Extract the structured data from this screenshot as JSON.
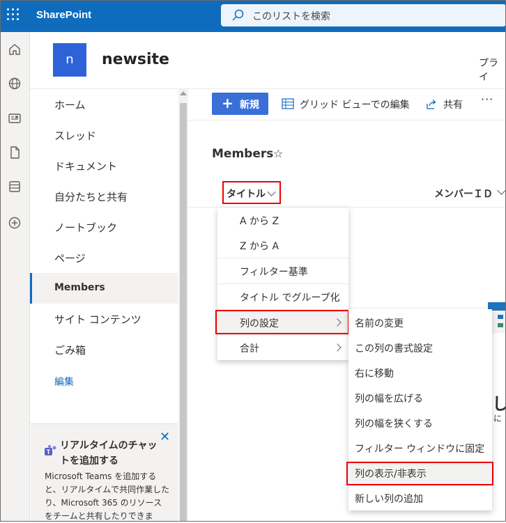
{
  "app": {
    "brand": "SharePoint"
  },
  "search": {
    "placeholder": "このリストを検索"
  },
  "rail": {
    "icons": [
      "home-icon",
      "globe-icon",
      "news-icon",
      "document-icon",
      "list-icon",
      "add-circle-icon"
    ]
  },
  "site": {
    "logo_letter": "n",
    "title": "newsite",
    "header_right_text": "プライ"
  },
  "nav": {
    "items": [
      {
        "label": "ホーム"
      },
      {
        "label": "スレッド"
      },
      {
        "label": "ドキュメント"
      },
      {
        "label": "自分たちと共有"
      },
      {
        "label": "ノートブック"
      },
      {
        "label": "ページ"
      },
      {
        "label": "Members",
        "active": true
      },
      {
        "label": "サイト コンテンツ"
      },
      {
        "label": "ごみ箱"
      }
    ],
    "edit_label": "編集"
  },
  "promo": {
    "title": "リアルタイムのチャットを追加する",
    "body": "Microsoft Teams を追加すると、リアルタイムで共同作業したり、Microsoft 365 のリソースをチームと共有したりできま"
  },
  "toolbar": {
    "new_label": "新規",
    "grid_edit_label": "グリッド ビューでの編集",
    "share_label": "共有",
    "more_label": "···"
  },
  "list": {
    "title": "Members",
    "columns": [
      {
        "label": "タイトル"
      },
      {
        "label": "メンバーＩＤ"
      }
    ]
  },
  "column_menu": {
    "items": [
      {
        "label": "A から Z"
      },
      {
        "label": "Z から A"
      },
      {
        "label": "フィルター基準"
      },
      {
        "label": "タイトル でグループ化"
      },
      {
        "label": "列の設定",
        "submenu": true,
        "highlighted": true
      },
      {
        "label": "合計",
        "submenu": true
      }
    ]
  },
  "settings_submenu": {
    "items": [
      {
        "label": "名前の変更"
      },
      {
        "label": "この列の書式設定"
      },
      {
        "label": "右に移動"
      },
      {
        "label": "列の幅を広げる"
      },
      {
        "label": "列の幅を狭くする"
      },
      {
        "label": "フィルター ウィンドウに固定"
      },
      {
        "label": "列の表示/非表示",
        "highlighted": true
      },
      {
        "label": "新しい列の追加"
      }
    ]
  },
  "peek": {
    "big_text": "し",
    "small_text": "に"
  },
  "colors": {
    "accent": "#0f6cbd",
    "new_button": "#3a6fd8",
    "highlight_box": "#ee0000"
  }
}
